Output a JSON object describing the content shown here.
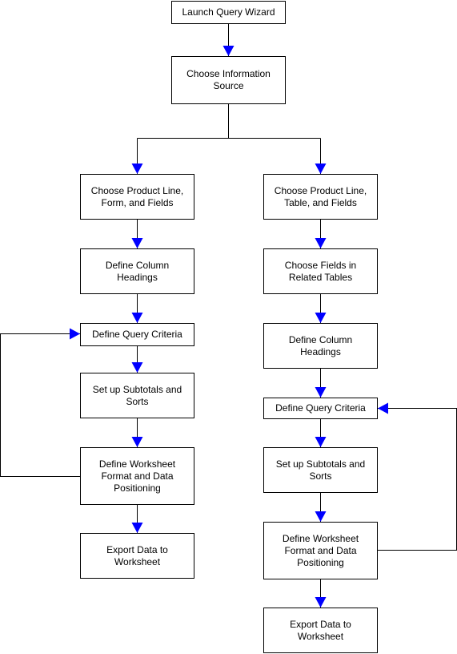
{
  "diagram": {
    "type": "flowchart",
    "accent_color": "#0000ff",
    "line_color": "#000000",
    "nodes": {
      "launch": "Launch Query Wizard",
      "source": "Choose Information Source",
      "left": [
        "Choose Product Line, Form, and Fields",
        "Define Column Headings",
        "Define Query Criteria",
        "Set up Subtotals and Sorts",
        "Define Worksheet Format and Data Positioning",
        "Export Data to Worksheet"
      ],
      "right": [
        "Choose Product Line, Table, and Fields",
        "Choose Fields in Related Tables",
        "Define Column Headings",
        "Define Query Criteria",
        "Set up Subtotals and Sorts",
        "Define Worksheet Format and Data Positioning",
        "Export Data to Worksheet"
      ]
    },
    "edges": [
      {
        "from": "launch",
        "to": "source"
      },
      {
        "from": "source",
        "to": "left.0"
      },
      {
        "from": "source",
        "to": "right.0"
      },
      {
        "from": "left.0",
        "to": "left.1"
      },
      {
        "from": "left.1",
        "to": "left.2"
      },
      {
        "from": "left.2",
        "to": "left.3"
      },
      {
        "from": "left.3",
        "to": "left.4"
      },
      {
        "from": "left.4",
        "to": "left.5"
      },
      {
        "from": "left.4",
        "to": "left.2",
        "type": "loop"
      },
      {
        "from": "right.0",
        "to": "right.1"
      },
      {
        "from": "right.1",
        "to": "right.2"
      },
      {
        "from": "right.2",
        "to": "right.3"
      },
      {
        "from": "right.3",
        "to": "right.4"
      },
      {
        "from": "right.4",
        "to": "right.5"
      },
      {
        "from": "right.5",
        "to": "right.6"
      },
      {
        "from": "right.5",
        "to": "right.3",
        "type": "loop"
      }
    ]
  }
}
